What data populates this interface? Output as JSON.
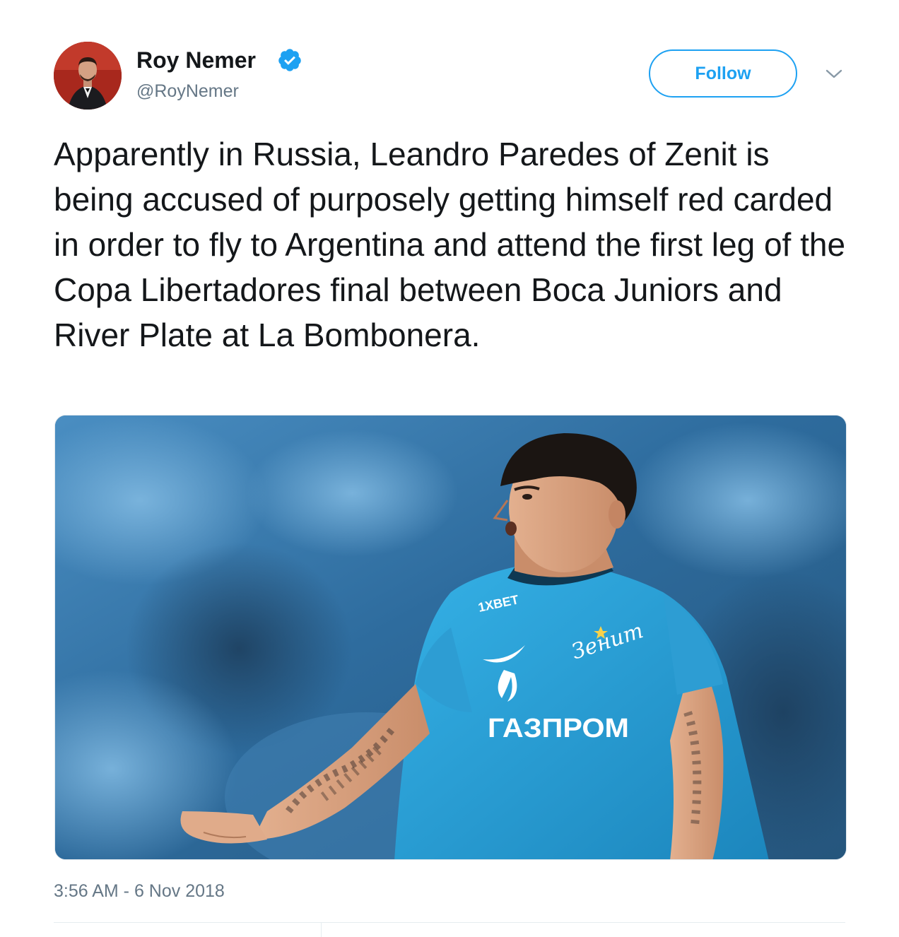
{
  "author": {
    "name": "Roy Nemer",
    "handle": "@RoyNemer",
    "verified": true
  },
  "actions": {
    "follow_label": "Follow",
    "menu_icon": "chevron-down-icon"
  },
  "tweet": {
    "text": "Apparently in Russia, Leandro Paredes of Zenit is being accused of purposely getting himself red carded in order to fly to Argentina and attend the first leg of the Copa Libertadores final between Boca Juniors and River Plate at La Bombonera.",
    "timestamp": "3:56 AM - 6 Nov 2018"
  },
  "media": {
    "shirt_sponsor": "ГАЗПРОМ",
    "shirt_club": "Зенит",
    "sleeve_sponsor": "1XBET"
  },
  "colors": {
    "accent": "#1da1f2",
    "text": "#14171a",
    "muted": "#657786",
    "shirt": "#2a9fd6"
  }
}
